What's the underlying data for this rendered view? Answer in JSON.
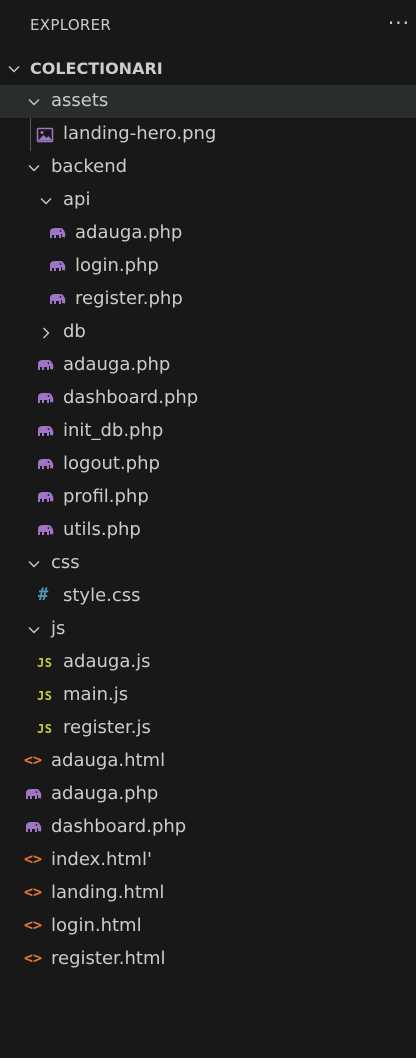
{
  "header": {
    "title": "EXPLORER",
    "more_label": "···"
  },
  "root": {
    "label": "COLECTIONARI"
  },
  "tree": [
    {
      "label": "assets",
      "type": "folder",
      "expanded": true,
      "depth": 1,
      "selected": true
    },
    {
      "label": "landing-hero.png",
      "type": "image",
      "depth": 2
    },
    {
      "label": "backend",
      "type": "folder",
      "expanded": true,
      "depth": 1
    },
    {
      "label": "api",
      "type": "folder",
      "expanded": true,
      "depth": 2
    },
    {
      "label": "adauga.php",
      "type": "php",
      "depth": 3
    },
    {
      "label": "login.php",
      "type": "php",
      "depth": 3
    },
    {
      "label": "register.php",
      "type": "php",
      "depth": 3
    },
    {
      "label": "db",
      "type": "folder",
      "expanded": false,
      "depth": 2
    },
    {
      "label": "adauga.php",
      "type": "php",
      "depth": 2
    },
    {
      "label": "dashboard.php",
      "type": "php",
      "depth": 2
    },
    {
      "label": "init_db.php",
      "type": "php",
      "depth": 2
    },
    {
      "label": "logout.php",
      "type": "php",
      "depth": 2
    },
    {
      "label": "profil.php",
      "type": "php",
      "depth": 2
    },
    {
      "label": "utils.php",
      "type": "php",
      "depth": 2
    },
    {
      "label": "css",
      "type": "folder",
      "expanded": true,
      "depth": 1
    },
    {
      "label": "style.css",
      "type": "css",
      "depth": 2
    },
    {
      "label": "js",
      "type": "folder",
      "expanded": true,
      "depth": 1
    },
    {
      "label": "adauga.js",
      "type": "js",
      "depth": 2
    },
    {
      "label": "main.js",
      "type": "js",
      "depth": 2
    },
    {
      "label": "register.js",
      "type": "js",
      "depth": 2
    },
    {
      "label": "adauga.html",
      "type": "html",
      "depth": 1
    },
    {
      "label": "adauga.php",
      "type": "php",
      "depth": 1
    },
    {
      "label": "dashboard.php",
      "type": "php",
      "depth": 1
    },
    {
      "label": "index.html'",
      "type": "html",
      "depth": 1
    },
    {
      "label": "landing.html",
      "type": "html",
      "depth": 1
    },
    {
      "label": "login.html",
      "type": "html",
      "depth": 1
    },
    {
      "label": "register.html",
      "type": "html",
      "depth": 1
    }
  ],
  "icons": {
    "js_text": "JS",
    "css_text": "#",
    "html_text": "<>"
  },
  "colors": {
    "background": "#181818",
    "text": "#cccccc",
    "selected_row": "#2a2d2e",
    "php_icon": "#a074c4",
    "js_icon": "#cbcb41",
    "css_icon": "#519aba",
    "html_icon": "#e37933",
    "image_icon": "#a074c4"
  }
}
